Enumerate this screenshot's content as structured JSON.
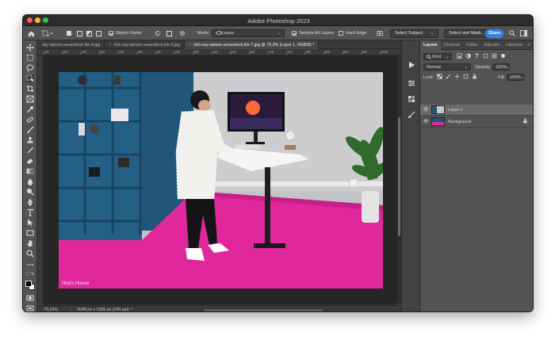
{
  "app": {
    "title": "Adobe Photoshop 2023"
  },
  "options_bar": {
    "mode_label": "Mode:",
    "mode_value": "Lasso",
    "object_finder": "Object Finder",
    "sample_all_layers": "Sample All Layers",
    "hard_edge": "Hard Edge",
    "select_subject": "Select Subject",
    "select_and_mask": "Select and Mask...",
    "share": "Share"
  },
  "tabs": [
    {
      "label": "-tay-epione-smartdeck-lite-4.jpg",
      "active": false
    },
    {
      "label": "trên-tay-epione-smartdeck-lite-5.jpg",
      "active": false
    },
    {
      "label": "trên-tay-epione-smartdeck-lite-7.jpg @ 79,2% (Layer 1, RGB/8) *",
      "active": true
    }
  ],
  "ruler": {
    "labels": [
      "100",
      "150",
      "200",
      "250",
      "300",
      "350",
      "400",
      "450",
      "500",
      "550",
      "600",
      "650",
      "700",
      "750",
      "800",
      "850",
      "900",
      "950",
      "1000",
      "1050",
      "1100",
      "1150",
      "1200",
      "1250",
      "1300",
      "1350",
      "1400",
      "1450",
      "1500",
      "1550",
      "1600",
      "1650",
      "1700",
      "1750",
      "1800",
      "1850",
      "1900",
      "1950",
      "2000",
      "2050",
      "2100",
      "2150"
    ]
  },
  "status": {
    "zoom": "79,19%",
    "doc_info": "2048 px x 1365 px (240 ppi)"
  },
  "image": {
    "watermark": "Hoa's House"
  },
  "layers_panel": {
    "tabs": [
      "Layers",
      "Channel",
      "Paths",
      "Adjustm",
      "Libraries"
    ],
    "kind": "Kind",
    "blend_mode": "Normal",
    "opacity_label": "Opacity:",
    "opacity_value": "100%",
    "lock_label": "Lock:",
    "fill_label": "Fill:",
    "fill_value": "100%",
    "layers": [
      {
        "name": "Layer 1",
        "selected": true,
        "locked": false
      },
      {
        "name": "Background",
        "selected": false,
        "locked": true
      }
    ]
  },
  "colors": {
    "floor_magenta": "#e0279b",
    "wall_blue": "#1f5679",
    "share_blue": "#2f80ed"
  }
}
